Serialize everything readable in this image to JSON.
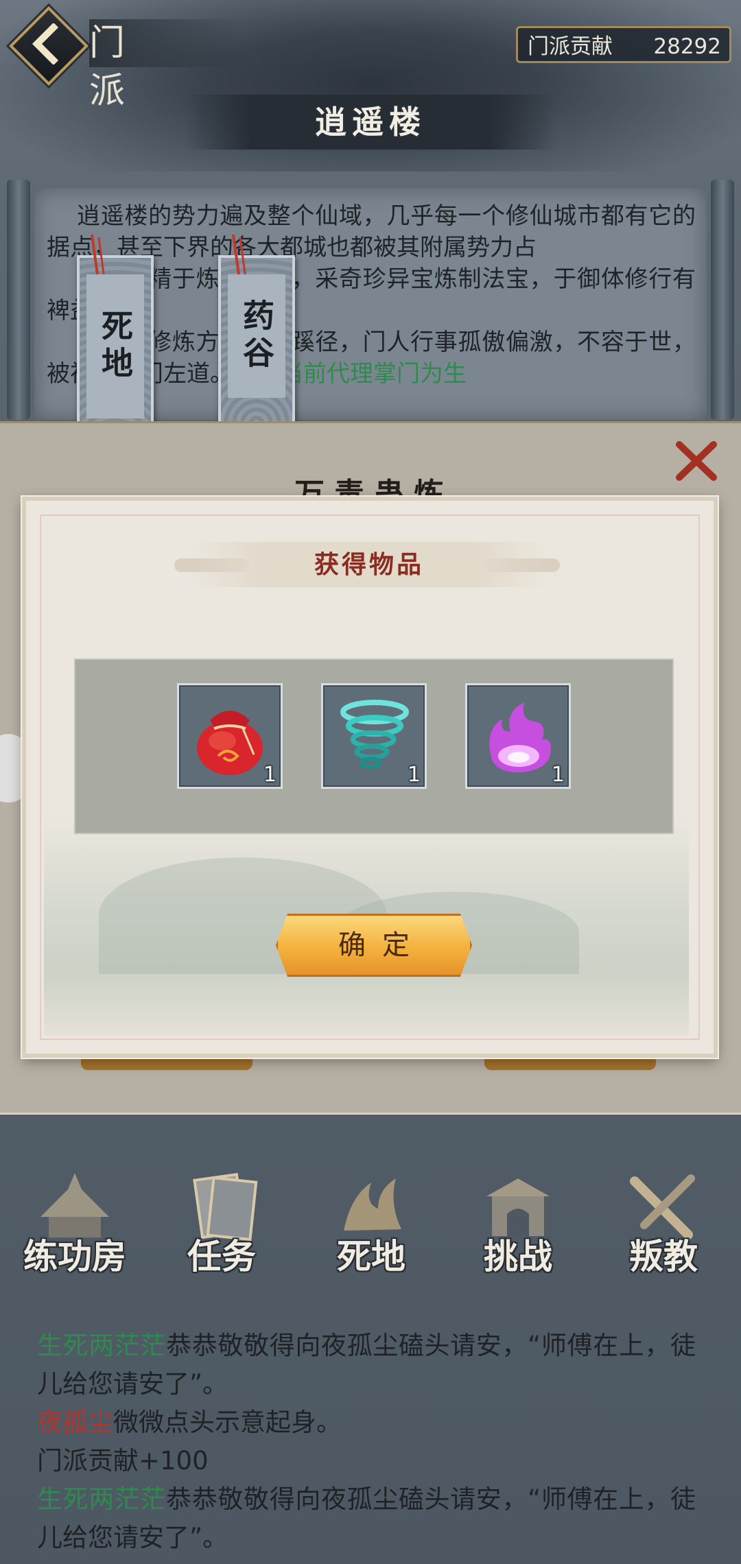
{
  "header": {
    "title": "门 派",
    "contribution_label": "门派贡献",
    "contribution_value": "28292"
  },
  "sect": {
    "name": "逍遥楼",
    "description_lines": [
      "逍遥楼的势力遍及整个仙域，几乎每一个修仙城市都有它的据点，甚至下界的各大都城也都被其附属势力占",
      "逍遥楼精于炼器之道，采奇珍异宝炼制法宝，于御体修行有裨益",
      "逍遥楼修炼方式另辟蹊径，门人行事孤傲偏激，不容于世，被视为旁门左道。"
    ],
    "highlight_text": "门派当前代理掌门为生",
    "tags": [
      "死地",
      "药谷"
    ]
  },
  "under_panel": {
    "title": "万毒蛊炼"
  },
  "dialog": {
    "title": "获得物品",
    "items": [
      {
        "icon": "red-pouch-icon",
        "count": "1"
      },
      {
        "icon": "cyan-whirlwind-icon",
        "count": "1"
      },
      {
        "icon": "purple-flame-icon",
        "count": "1"
      }
    ],
    "confirm_label": "确定"
  },
  "nav": [
    {
      "label": "练功房",
      "icon": "training-hall-icon"
    },
    {
      "label": "任务",
      "icon": "task-scroll-icon"
    },
    {
      "label": "死地",
      "icon": "death-land-icon"
    },
    {
      "label": "挑战",
      "icon": "challenge-gate-icon"
    },
    {
      "label": "叛教",
      "icon": "betray-swords-icon"
    }
  ],
  "log": {
    "entries": [
      {
        "speaker": "生死两茫茫",
        "text": "恭恭敬敬得向夜孤尘磕头请安，“师傅在上，徒儿给您请安了”。"
      },
      {
        "speaker": "夜孤尘",
        "text": "微微点头示意起身。"
      },
      {
        "speaker": "",
        "text": "门派贡献+100"
      },
      {
        "speaker": "生死两茫茫",
        "text": "恭恭敬敬得向夜孤尘磕头请安，“师傅在上，徒儿给您请安了”。"
      }
    ]
  },
  "colors": {
    "accent_gold": "#f4b13d",
    "dialog_title": "#8a2c22",
    "speaker_green": "#2e8b4e",
    "speaker_red": "#b8332b"
  }
}
